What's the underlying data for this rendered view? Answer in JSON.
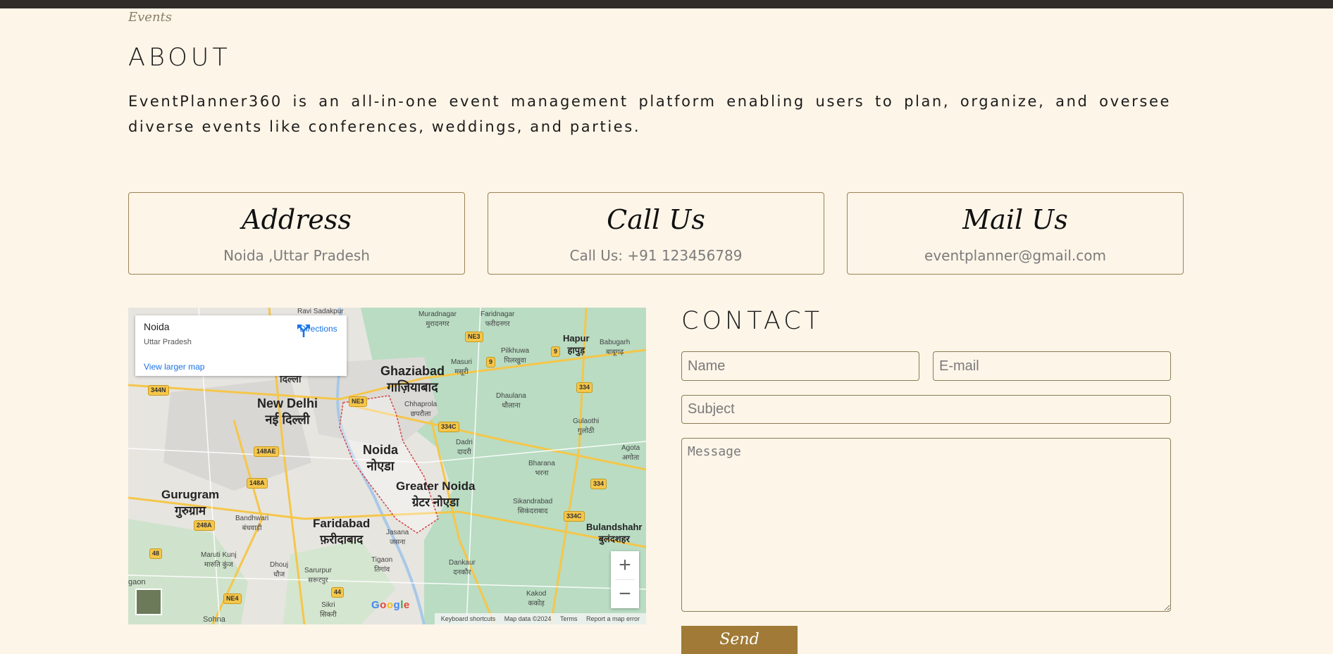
{
  "header": {
    "section_label": "Events"
  },
  "about": {
    "title": "ABOUT",
    "text": "EventPlanner360 is an all-in-one event management platform enabling users to plan, organize, and oversee diverse events like conferences, weddings, and parties."
  },
  "cards": [
    {
      "title": "Address",
      "value": "Noida ,Uttar Pradesh"
    },
    {
      "title": "Call Us",
      "value": "Call Us: +91 123456789"
    },
    {
      "title": "Mail Us",
      "value": "eventplanner@gmail.com"
    }
  ],
  "map": {
    "place_name": "Noida",
    "place_region": "Uttar Pradesh",
    "directions_label": "Directions",
    "larger_map_label": "View larger map",
    "zoom_in": "+",
    "zoom_out": "−",
    "google": "Google",
    "footer": {
      "shortcuts": "Keyboard shortcuts",
      "data": "Map data ©2024",
      "terms": "Terms",
      "report": "Report a map error"
    },
    "labels": {
      "ghaziabad": "Ghaziabad",
      "ghaziabad_hi": "गाज़ियाबाद",
      "new_delhi": "New Delhi",
      "new_delhi_hi": "नई दिल्ली",
      "delhi_hi": "दिल्ली",
      "noida": "Noida",
      "noida_hi": "नोएडा",
      "greater_noida": "Greater Noida",
      "greater_noida_hi": "ग्रेटर नोएडा",
      "gurugram": "Gurugram",
      "gurugram_hi": "गुरुग्राम",
      "faridabad": "Faridabad",
      "faridabad_hi": "फ़रीदाबाद",
      "hapur": "Hapur",
      "hapur_hi": "हापुड़",
      "bulandshahr": "Bulandshahr",
      "bulandshahr_hi": "बुलंदशहर",
      "muradnagar": "Muradnagar",
      "muradnagar_hi": "मुरादनगर",
      "faridnagar": "Faridnagar",
      "faridnagar_hi": "फरीदनगर",
      "pilkhuwa": "Pilkhuwa",
      "pilkhuwa_hi": "पिलखुवा",
      "babugarh": "Babugarh",
      "babugarh_hi": "बाबूगढ़",
      "masuri": "Masuri",
      "masuri_hi": "मसूरी",
      "dhaulana": "Dhaulana",
      "dhaulana_hi": "धौलाना",
      "chhaprola": "Chhaprola",
      "chhaprola_hi": "छपरौला",
      "gulaothi": "Gulaothi",
      "gulaothi_hi": "गुलोठी",
      "dadri": "Dadri",
      "dadri_hi": "दादरी",
      "agota": "Agota",
      "agota_hi": "अगोता",
      "bharana": "Bharana",
      "bharana_hi": "भरना",
      "sikandrabad": "Sikandrabad",
      "sikandrabad_hi": "सिकंदराबाद",
      "bandhwari": "Bandhwari",
      "bandhwari_hi": "बंधवाड़ी",
      "maruti_kunj": "Maruti Kunj",
      "maruti_kunj_hi": "मारुति कुंज",
      "dhouj": "Dhouj",
      "dhouj_hi": "धौज",
      "sarurpur": "Sarurpur",
      "sarurpur_hi": "सरूरपुर",
      "jasana": "Jasana",
      "jasana_hi": "जसना",
      "tigaon": "Tigaon",
      "tigaon_hi": "तिगांव",
      "dankaur": "Dankaur",
      "dankaur_hi": "दनकौर",
      "kakod": "Kakod",
      "kakod_hi": "ककोड़",
      "sikri": "Sikri",
      "sikri_hi": "सिकरी",
      "sohna": "Sohna",
      "gaon": "gaon",
      "ravi_sadakpur": "Ravi Sadakpur"
    },
    "shields": [
      "344N",
      "NE3",
      "NE3",
      "9",
      "9",
      "334",
      "334C",
      "148AE",
      "148A",
      "334",
      "334C",
      "248A",
      "48",
      "44",
      "NE4"
    ]
  },
  "contact": {
    "title": "CONTACT",
    "name_placeholder": "Name",
    "email_placeholder": "E-mail",
    "subject_placeholder": "Subject",
    "message_placeholder": "Message",
    "send_label": "Send"
  }
}
